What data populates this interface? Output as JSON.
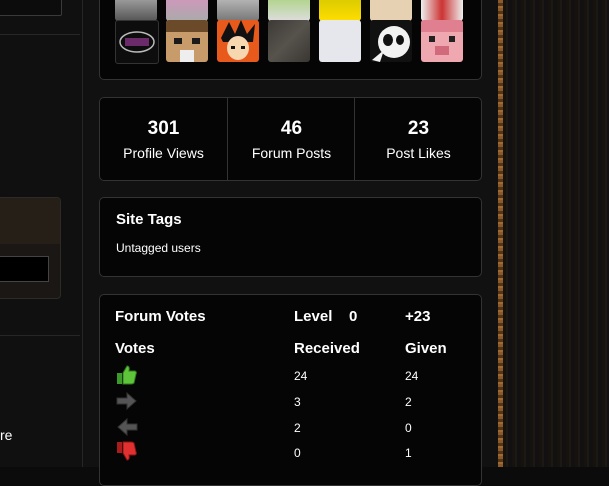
{
  "left": {
    "partial_text": "re"
  },
  "stats": [
    {
      "value": "301",
      "label": "Profile Views"
    },
    {
      "value": "46",
      "label": "Forum Posts"
    },
    {
      "value": "23",
      "label": "Post Likes"
    }
  ],
  "tags": {
    "title": "Site Tags",
    "text": "Untagged users"
  },
  "votes": {
    "title": "Forum Votes",
    "level_label": "Level",
    "level_value": "0",
    "score": "+23",
    "col_votes": "Votes",
    "col_received": "Received",
    "col_given": "Given",
    "rows": [
      {
        "icon": "thumbs-up-icon",
        "received": "24",
        "given": "24"
      },
      {
        "icon": "arrow-right-icon",
        "received": "3",
        "given": "2"
      },
      {
        "icon": "arrow-left-icon",
        "received": "2",
        "given": "0"
      },
      {
        "icon": "thumbs-down-icon",
        "received": "0",
        "given": "1"
      }
    ]
  },
  "avatars": {
    "count": 14
  }
}
